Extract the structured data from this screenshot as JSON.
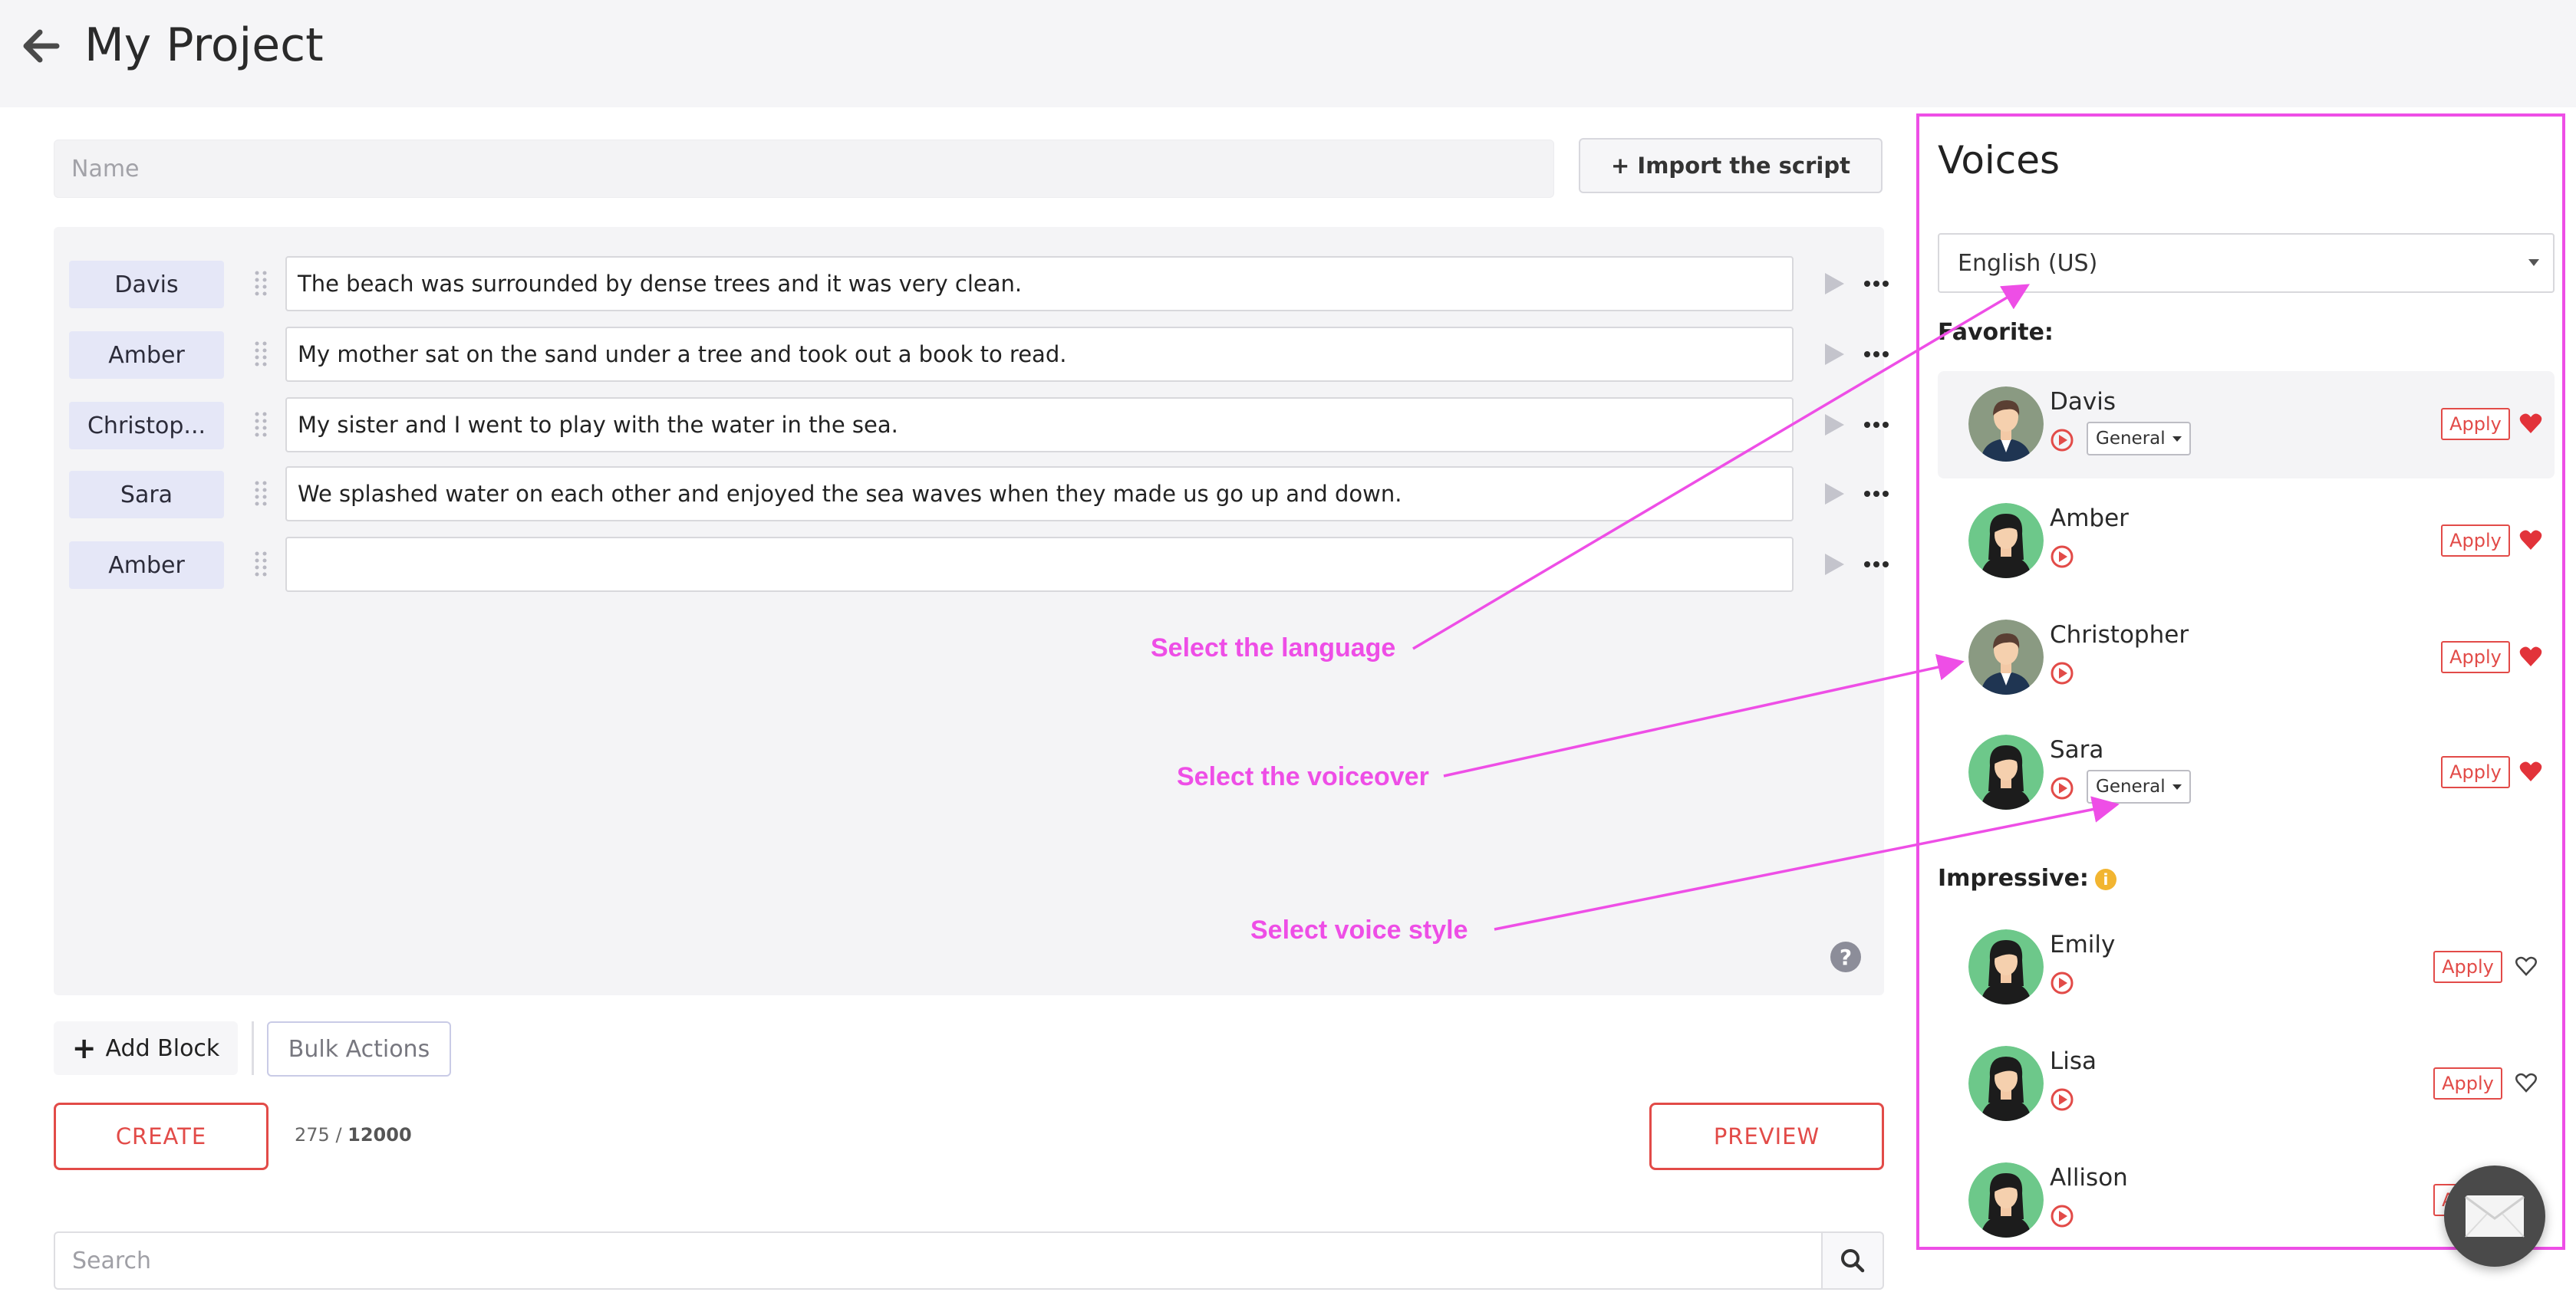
{
  "header": {
    "title": "My Project",
    "back_icon": "arrow-left-icon"
  },
  "editor": {
    "name_placeholder": "Name",
    "name_value": "",
    "import_label": "+ Import the script",
    "blocks": [
      {
        "speaker": "Davis",
        "text": "The beach was surrounded by dense trees and it was very clean."
      },
      {
        "speaker": "Amber",
        "text": "My mother sat on the sand under a tree and took out a book to read."
      },
      {
        "speaker": "Christop...",
        "text": "My sister and I went to play with the water in the sea."
      },
      {
        "speaker": "Sara",
        "text": "We splashed water on each other and enjoyed the sea waves when they made us go up and down."
      },
      {
        "speaker": "Amber",
        "text": ""
      }
    ],
    "help_label": "?",
    "add_block_label": "Add Block",
    "bulk_actions_label": "Bulk Actions",
    "create_label": "CREATE",
    "char_count_used": "275",
    "char_count_sep": " / ",
    "char_count_max": "12000",
    "preview_label": "PREVIEW",
    "search_placeholder": "Search"
  },
  "voices": {
    "title": "Voices",
    "language": "English (US)",
    "favorite_label": "Favorite:",
    "impressive_label": "Impressive:",
    "info_label": "i",
    "apply_label": "Apply",
    "favorites": [
      {
        "name": "Davis",
        "gender": "male",
        "style": "General",
        "favorite": true
      },
      {
        "name": "Amber",
        "gender": "female",
        "favorite": true
      },
      {
        "name": "Christopher",
        "gender": "male",
        "favorite": true
      },
      {
        "name": "Sara",
        "gender": "female",
        "style": "General",
        "favorite": true
      }
    ],
    "impressive": [
      {
        "name": "Emily",
        "gender": "female",
        "favorite": false
      },
      {
        "name": "Lisa",
        "gender": "female",
        "favorite": false
      },
      {
        "name": "Allison",
        "gender": "female",
        "favorite": false
      }
    ]
  },
  "annotations": {
    "language": "Select the language",
    "voiceover": "Select the voiceover",
    "style": "Select voice style",
    "color": "#ee4ee6"
  },
  "colors": {
    "accent": "#e24b48",
    "highlight": "#ee4ee6",
    "tag_bg": "#e5e7f7",
    "avatar_bg": "#6dc88a"
  }
}
